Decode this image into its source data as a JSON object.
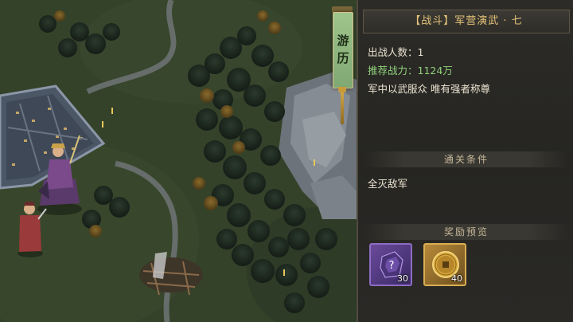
{
  "banner": {
    "text": "游\n历"
  },
  "panel": {
    "title": "【战斗】军营演武 · 七",
    "participants": {
      "label": "出战人数：",
      "value": "1"
    },
    "recommended_power": {
      "label": "推荐战力：",
      "value": "1124万"
    },
    "description": "军中以武服众  唯有强者称尊",
    "clear_condition": {
      "header": "通关条件",
      "text": "全灭敌军"
    },
    "rewards": {
      "header": "奖励预览",
      "items": [
        {
          "icon": "mystery-item-icon",
          "count": "30",
          "color": "#6a4a9a"
        },
        {
          "icon": "gold-coin-icon",
          "count": "40",
          "color": "#b88a3a"
        }
      ]
    }
  },
  "colors": {
    "accent_gold": "#e4c37a",
    "power_green": "#8fd17a",
    "banner_green": "#9fc48c"
  }
}
